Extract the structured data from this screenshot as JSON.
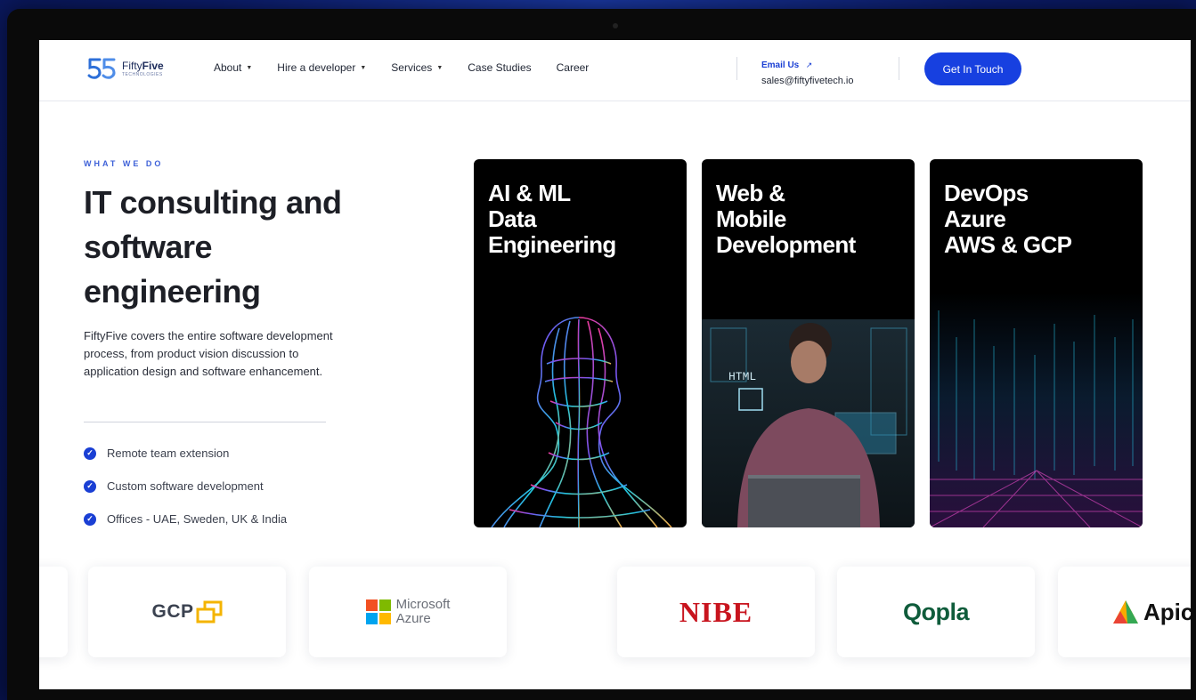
{
  "header": {
    "logo": {
      "name_light": "Fifty",
      "name_bold": "Five",
      "subtitle": "TECHNOLOGIES"
    },
    "nav": [
      {
        "label": "About",
        "dropdown": true
      },
      {
        "label": "Hire a developer",
        "dropdown": true
      },
      {
        "label": "Services",
        "dropdown": true
      },
      {
        "label": "Case Studies",
        "dropdown": false
      },
      {
        "label": "Career",
        "dropdown": false
      }
    ],
    "email_label": "Email Us",
    "email_address": "sales@fiftyfivetech.io",
    "cta_label": "Get In Touch"
  },
  "hero": {
    "eyebrow": "WHAT WE DO",
    "title": "IT consulting and software engineering",
    "description": "FiftyFive covers the entire software development process, from product vision discussion to application design and software enhancement.",
    "checklist": [
      "Remote team extension",
      "Custom software development",
      "Offices - UAE, Sweden, UK & India"
    ]
  },
  "services": [
    {
      "title": "AI & ML\nData\nEngineering"
    },
    {
      "title": "Web &\nMobile\nDevelopment"
    },
    {
      "title": "DevOps\nAzure\nAWS & GCP"
    }
  ],
  "partners": {
    "gcp": "GCP",
    "microsoft_line1": "Microsoft",
    "microsoft_line2": "Azure",
    "nibe": "NIBE",
    "qopla": "Qopla",
    "apic": "Apic"
  },
  "colors": {
    "accent": "#1740e0",
    "eyebrow": "#3e61d8",
    "nibe_red": "#c8141e",
    "qopla_green": "#0f5c3b"
  }
}
